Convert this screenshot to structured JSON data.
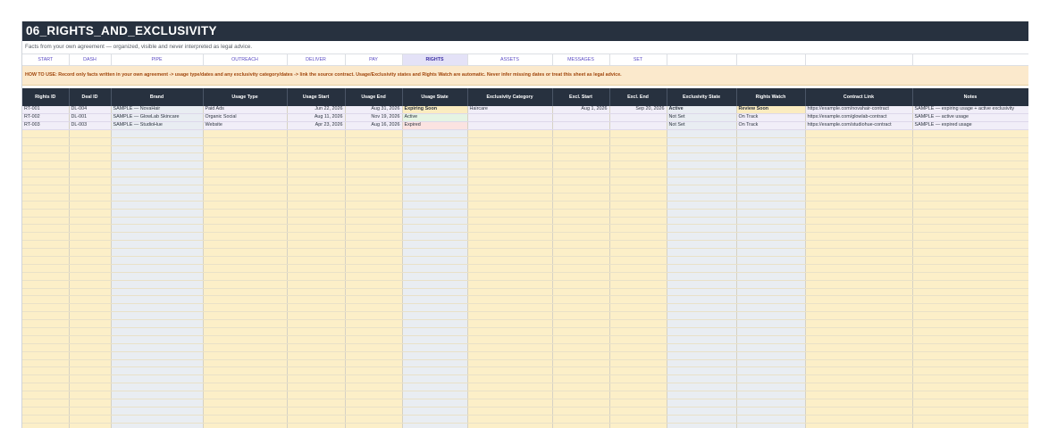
{
  "title": "06_RIGHTS_AND_EXCLUSIVITY",
  "subtitle": "Facts from your own agreement — organized, visible and never interpreted as legal advice.",
  "nav": [
    "START",
    "DASH",
    "PIPE",
    "OUTREACH",
    "DELIVER",
    "PAY",
    "RIGHTS",
    "ASSETS",
    "MESSAGES",
    "SET",
    "",
    "",
    "",
    ""
  ],
  "nav_selected": "RIGHTS",
  "howto": "HOW TO USE: Record only facts written in your own agreement -> usage type/dates and any exclusivity category/dates -> link the source contract. Usage/Exclusivity states and Rights Watch are automatic. Never infer missing dates or treat this sheet as legal advice.",
  "columns": [
    "Rights ID",
    "Deal ID",
    "Brand",
    "Usage Type",
    "Usage Start",
    "Usage End",
    "Usage State",
    "Exclusivity Category",
    "Excl. Start",
    "Excl. End",
    "Exclusivity State",
    "Rights Watch",
    "Contract Link",
    "Notes"
  ],
  "rows": [
    {
      "rights_id": "RT-001",
      "deal_id": "DL-004",
      "brand": "SAMPLE — NovaHair",
      "usage_type": "Paid Ads",
      "usage_start": "Jun 22, 2026",
      "usage_end": "Aug 31, 2026",
      "usage_state": "Expiring Soon",
      "excl_category": "Haircare",
      "excl_start": "Aug 1, 2026",
      "excl_end": "Sep 20, 2026",
      "excl_state": "Active",
      "rights_watch": "Review Soon",
      "contract_link": "https://example.com/novahair-contract",
      "notes": "SAMPLE — expiring usage + active exclusivity"
    },
    {
      "rights_id": "RT-002",
      "deal_id": "DL-001",
      "brand": "SAMPLE — GlowLab Skincare",
      "usage_type": "Organic Social",
      "usage_start": "Aug 11, 2026",
      "usage_end": "Nov 19, 2026",
      "usage_state": "Active",
      "excl_category": "",
      "excl_start": "",
      "excl_end": "",
      "excl_state": "Not Set",
      "rights_watch": "On Track",
      "contract_link": "https://example.com/glowlab-contract",
      "notes": "SAMPLE — active usage"
    },
    {
      "rights_id": "RT-003",
      "deal_id": "DL-003",
      "brand": "SAMPLE — StudioHue",
      "usage_type": "Website",
      "usage_start": "Apr 23, 2026",
      "usage_end": "Aug 16, 2026",
      "usage_state": "Expired",
      "excl_category": "",
      "excl_start": "",
      "excl_end": "",
      "excl_state": "Not Set",
      "rights_watch": "On Track",
      "contract_link": "https://example.com/studiohue-contract",
      "notes": "SAMPLE — expired usage"
    }
  ],
  "empty_row_count": 38,
  "colors": {
    "header_bg": "#27313f",
    "howto_bg": "#fbe9cc",
    "howto_text": "#a0460c",
    "nav_text": "#5b4cc4",
    "empty_row_bg": "#fcefc8",
    "data_row_bg": "#f1eef8",
    "expiring": "#a35c00",
    "active": "#2f7d32",
    "expired": "#c0392b"
  }
}
